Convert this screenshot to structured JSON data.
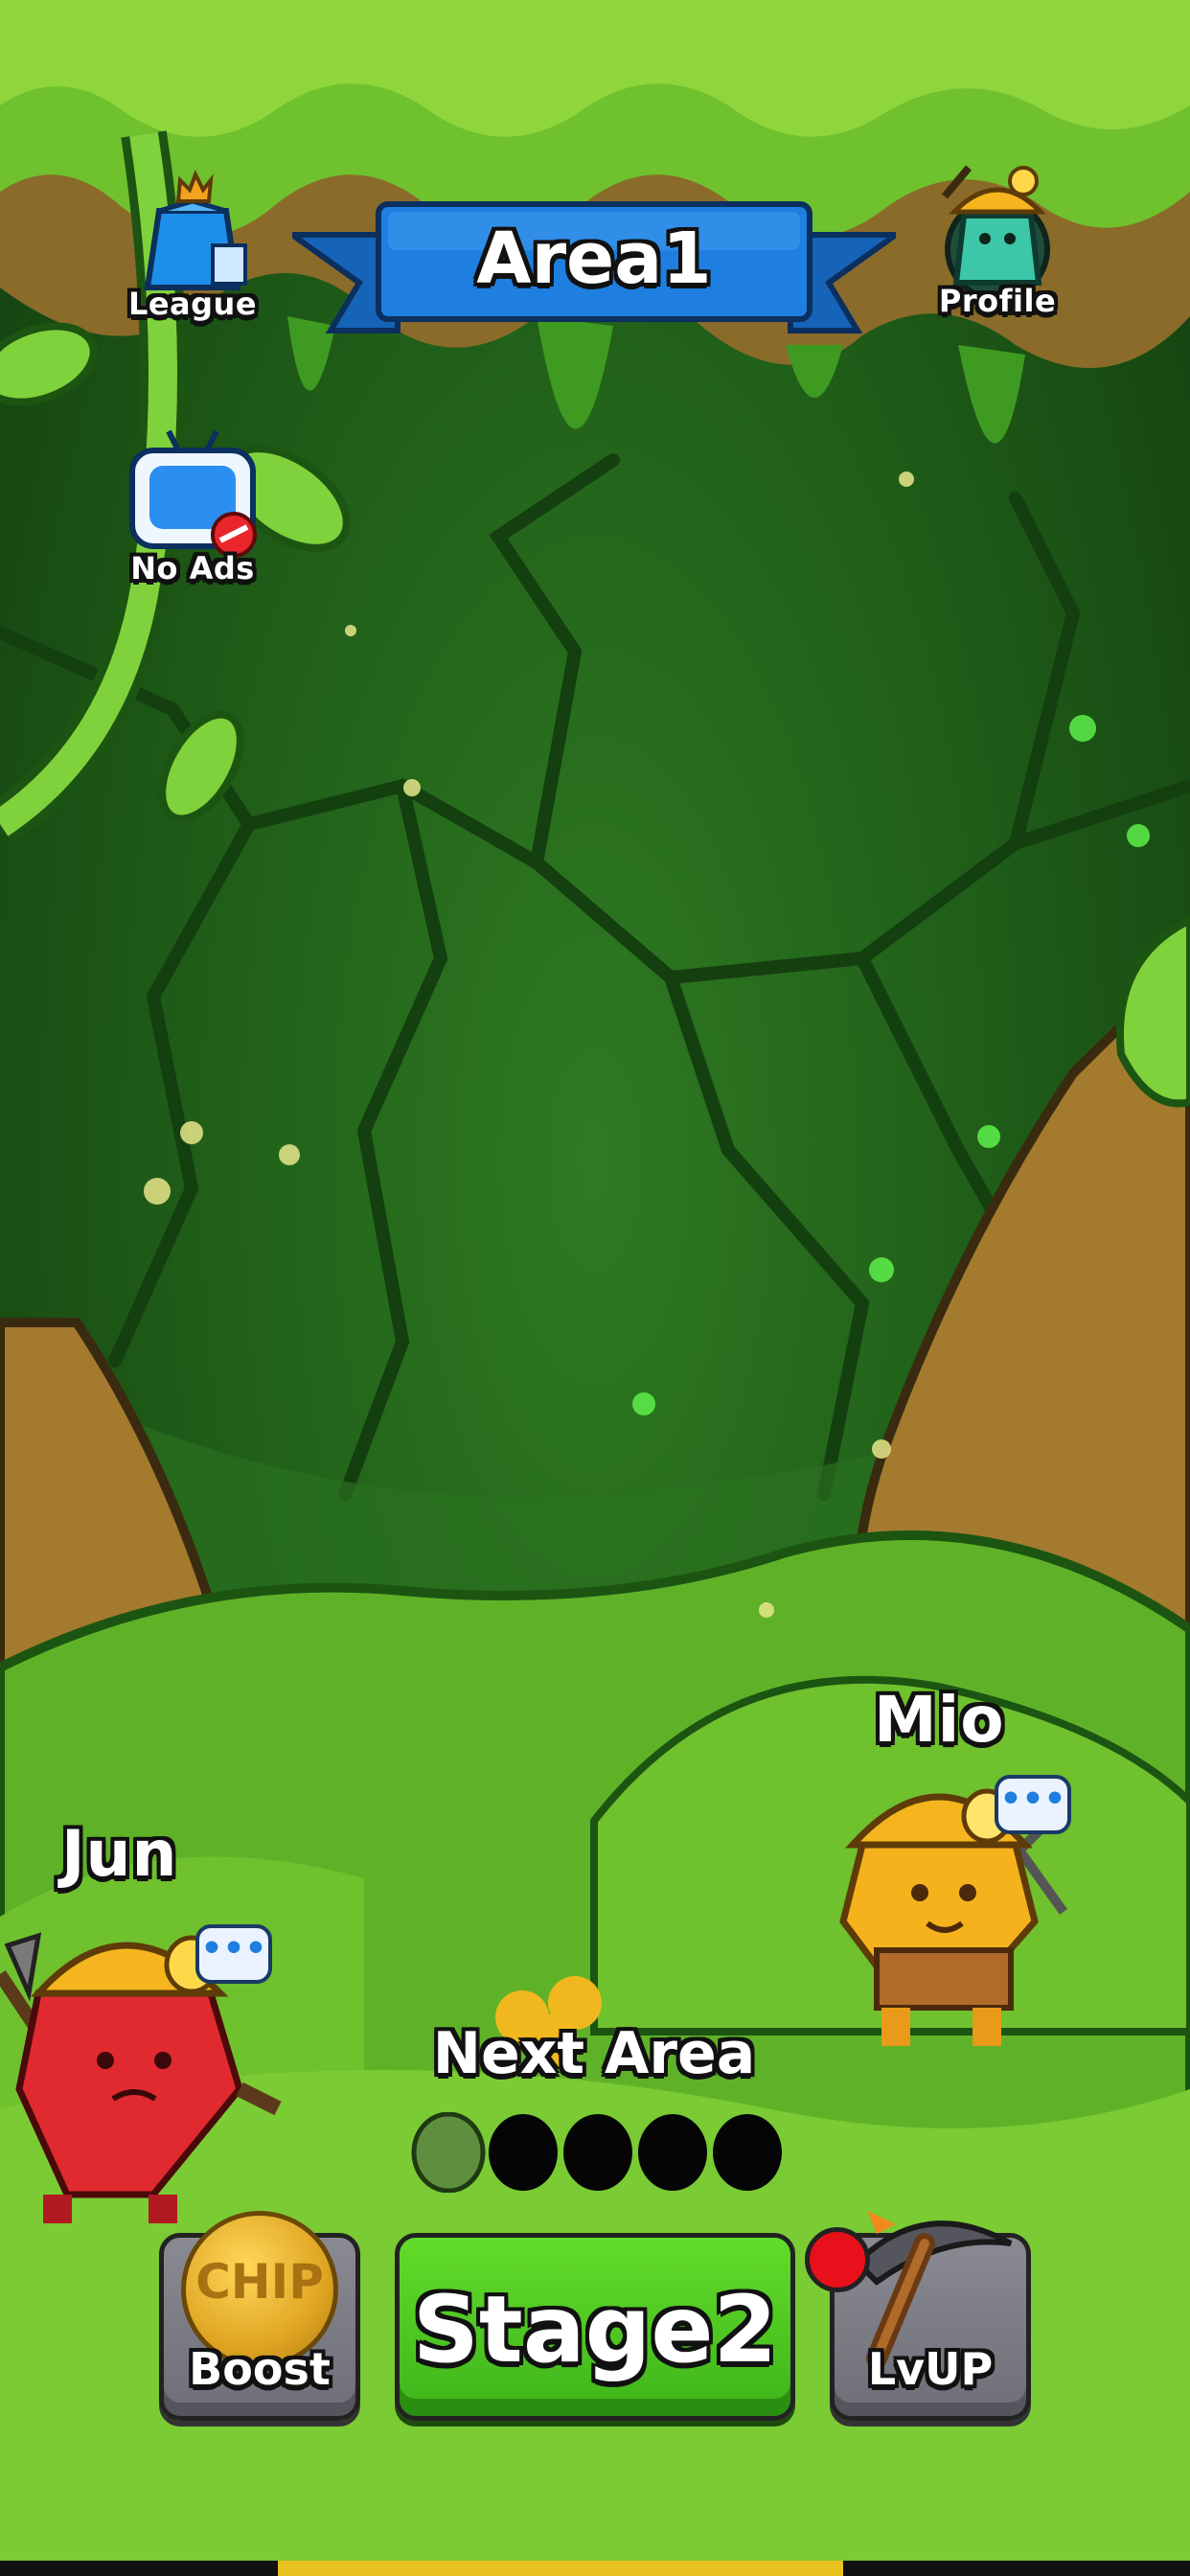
{
  "header": {
    "area_title": "Area1"
  },
  "menu": {
    "league_label": "League",
    "profile_label": "Profile",
    "noads_label": "No Ads"
  },
  "characters": {
    "left_name": "Jun",
    "right_name": "Mio"
  },
  "progress": {
    "label": "Next Area",
    "total_slots": 5,
    "filled_slots": 1
  },
  "actions": {
    "boost_label": "Boost",
    "chip_text": "CHIP",
    "stage_label": "Stage2",
    "lvup_label": "LvUP"
  },
  "colors": {
    "banner_blue": "#1e7fe0",
    "stage_green": "#4cc620",
    "notification_red": "#e8101a",
    "coin_gold": "#e0a623"
  }
}
